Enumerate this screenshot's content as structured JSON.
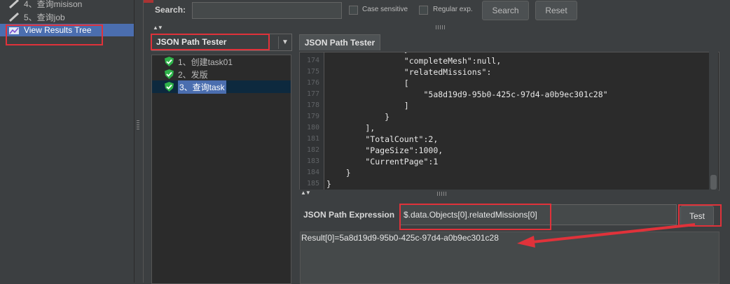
{
  "tree": {
    "items": [
      {
        "label": "4、查询misison"
      },
      {
        "label": "5、查询job"
      },
      {
        "label": "View Results Tree"
      }
    ]
  },
  "search": {
    "label": "Search:",
    "value": "",
    "case_sensitive_label": "Case sensitive",
    "regular_exp_label": "Regular exp.",
    "search_button": "Search",
    "reset_button": "Reset"
  },
  "renderer": {
    "selected": "JSON Path Tester",
    "dropdown_glyph": "▼"
  },
  "samples": [
    {
      "label": "1、创建task01"
    },
    {
      "label": "2、发版"
    },
    {
      "label": "3、查询task"
    }
  ],
  "tab": {
    "label": "JSON Path Tester"
  },
  "editor": {
    "lines": [
      {
        "n": "174",
        "text": "                \"completeMesh\":null,"
      },
      {
        "n": "175",
        "text": "                \"relatedMissions\":"
      },
      {
        "n": "176",
        "text": "                ["
      },
      {
        "n": "177",
        "text": "                    \"5a8d19d9-95b0-425c-97d4-a0b9ec301c28\""
      },
      {
        "n": "178",
        "text": "                ]"
      },
      {
        "n": "179",
        "text": "            }"
      },
      {
        "n": "180",
        "text": "        ],"
      },
      {
        "n": "181",
        "text": "        \"TotalCount\":2,"
      },
      {
        "n": "182",
        "text": "        \"PageSize\":1000,"
      },
      {
        "n": "183",
        "text": "        \"CurrentPage\":1"
      },
      {
        "n": "184",
        "text": "    }"
      },
      {
        "n": "185",
        "text": "}"
      }
    ]
  },
  "expression": {
    "label": "JSON Path Expression",
    "value": "$.data.Objects[0].relatedMissions[0]",
    "test_button": "Test"
  },
  "result": {
    "text": "Result[0]=5a8d19d9-95b0-425c-97d4-a0b9ec301c28"
  },
  "colors": {
    "annotation": "#e0323a",
    "selection": "#4b6eaf",
    "shield": "#2fb34a"
  }
}
